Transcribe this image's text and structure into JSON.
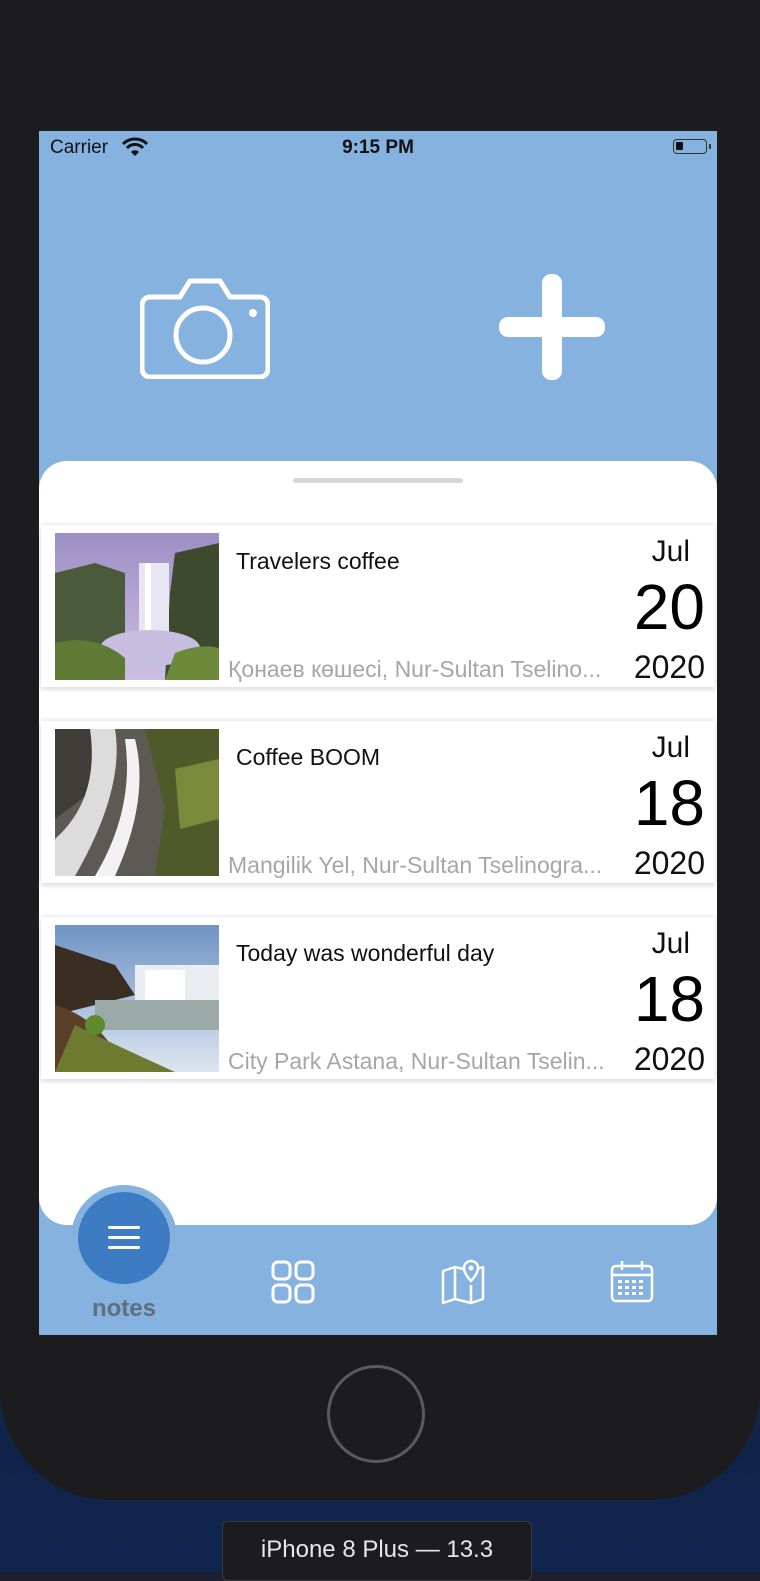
{
  "status_bar": {
    "carrier": "Carrier",
    "time": "9:15 PM"
  },
  "header": {
    "camera_icon": "camera-icon",
    "add_icon": "plus-icon"
  },
  "notes": [
    {
      "title": "Travelers coffee",
      "address": "Қонаев көшесі, Nur-Sultan Tselino...",
      "month": "Jul",
      "day": "20",
      "year": "2020"
    },
    {
      "title": "Coffee BOOM",
      "address": "Mangilik Yel, Nur-Sultan Tselinogra...",
      "month": "Jul",
      "day": "18",
      "year": "2020"
    },
    {
      "title": "Today was wonderful day",
      "address": "City Park Astana, Nur-Sultan Tselin...",
      "month": "Jul",
      "day": "18",
      "year": "2020"
    }
  ],
  "tab_bar": {
    "notes_label": "notes",
    "tabs": [
      "menu-icon",
      "grid-icon",
      "map-icon",
      "calendar-icon"
    ]
  },
  "device_label": "iPhone 8 Plus — 13.3",
  "colors": {
    "header_bg": "#85b2df",
    "accent": "#3d7cc2",
    "device": "#1c1c1e"
  }
}
